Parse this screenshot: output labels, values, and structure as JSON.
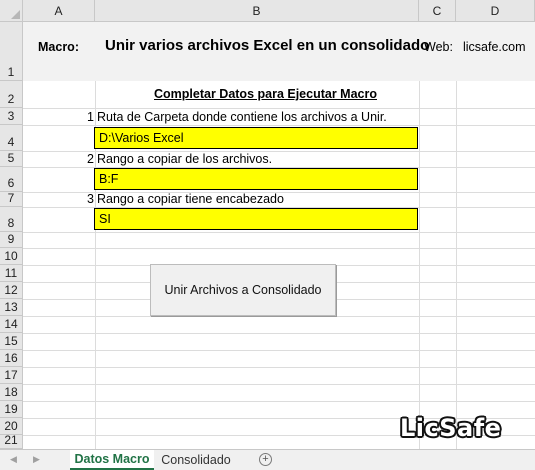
{
  "sheet": {
    "columns": [
      "A",
      "B",
      "C",
      "D"
    ],
    "rows": [
      "1",
      "2",
      "3",
      "4",
      "5",
      "6",
      "7",
      "8",
      "9",
      "10",
      "11",
      "12",
      "13",
      "14",
      "15",
      "16",
      "17",
      "18",
      "19",
      "20",
      "21"
    ]
  },
  "header": {
    "macro_label": "Macro:",
    "title": "Unir varios archivos Excel en un consolidado",
    "web_label": "Web:",
    "web_value": "licsafe.com"
  },
  "form": {
    "section_title": "Completar Datos para Ejecutar Macro",
    "fields": [
      {
        "number": "1",
        "label": "Ruta de Carpeta donde contiene los archivos a Unir.",
        "value": "D:\\Varios Excel"
      },
      {
        "number": "2",
        "label": "Rango a copiar de los archivos.",
        "value": "B:F"
      },
      {
        "number": "3",
        "label": "Rango a copiar tiene encabezado",
        "value": "SI"
      }
    ],
    "fill_color": "#ffff00"
  },
  "action_button": {
    "label": "Unir Archivos a Consolidado"
  },
  "tabs": [
    {
      "label": "Datos Macro",
      "active": true
    },
    {
      "label": "Consolidado",
      "active": false
    }
  ],
  "tab_add_icon": "plus-circle-icon",
  "accent_color": "#217346",
  "logo_text": "LicSafe"
}
